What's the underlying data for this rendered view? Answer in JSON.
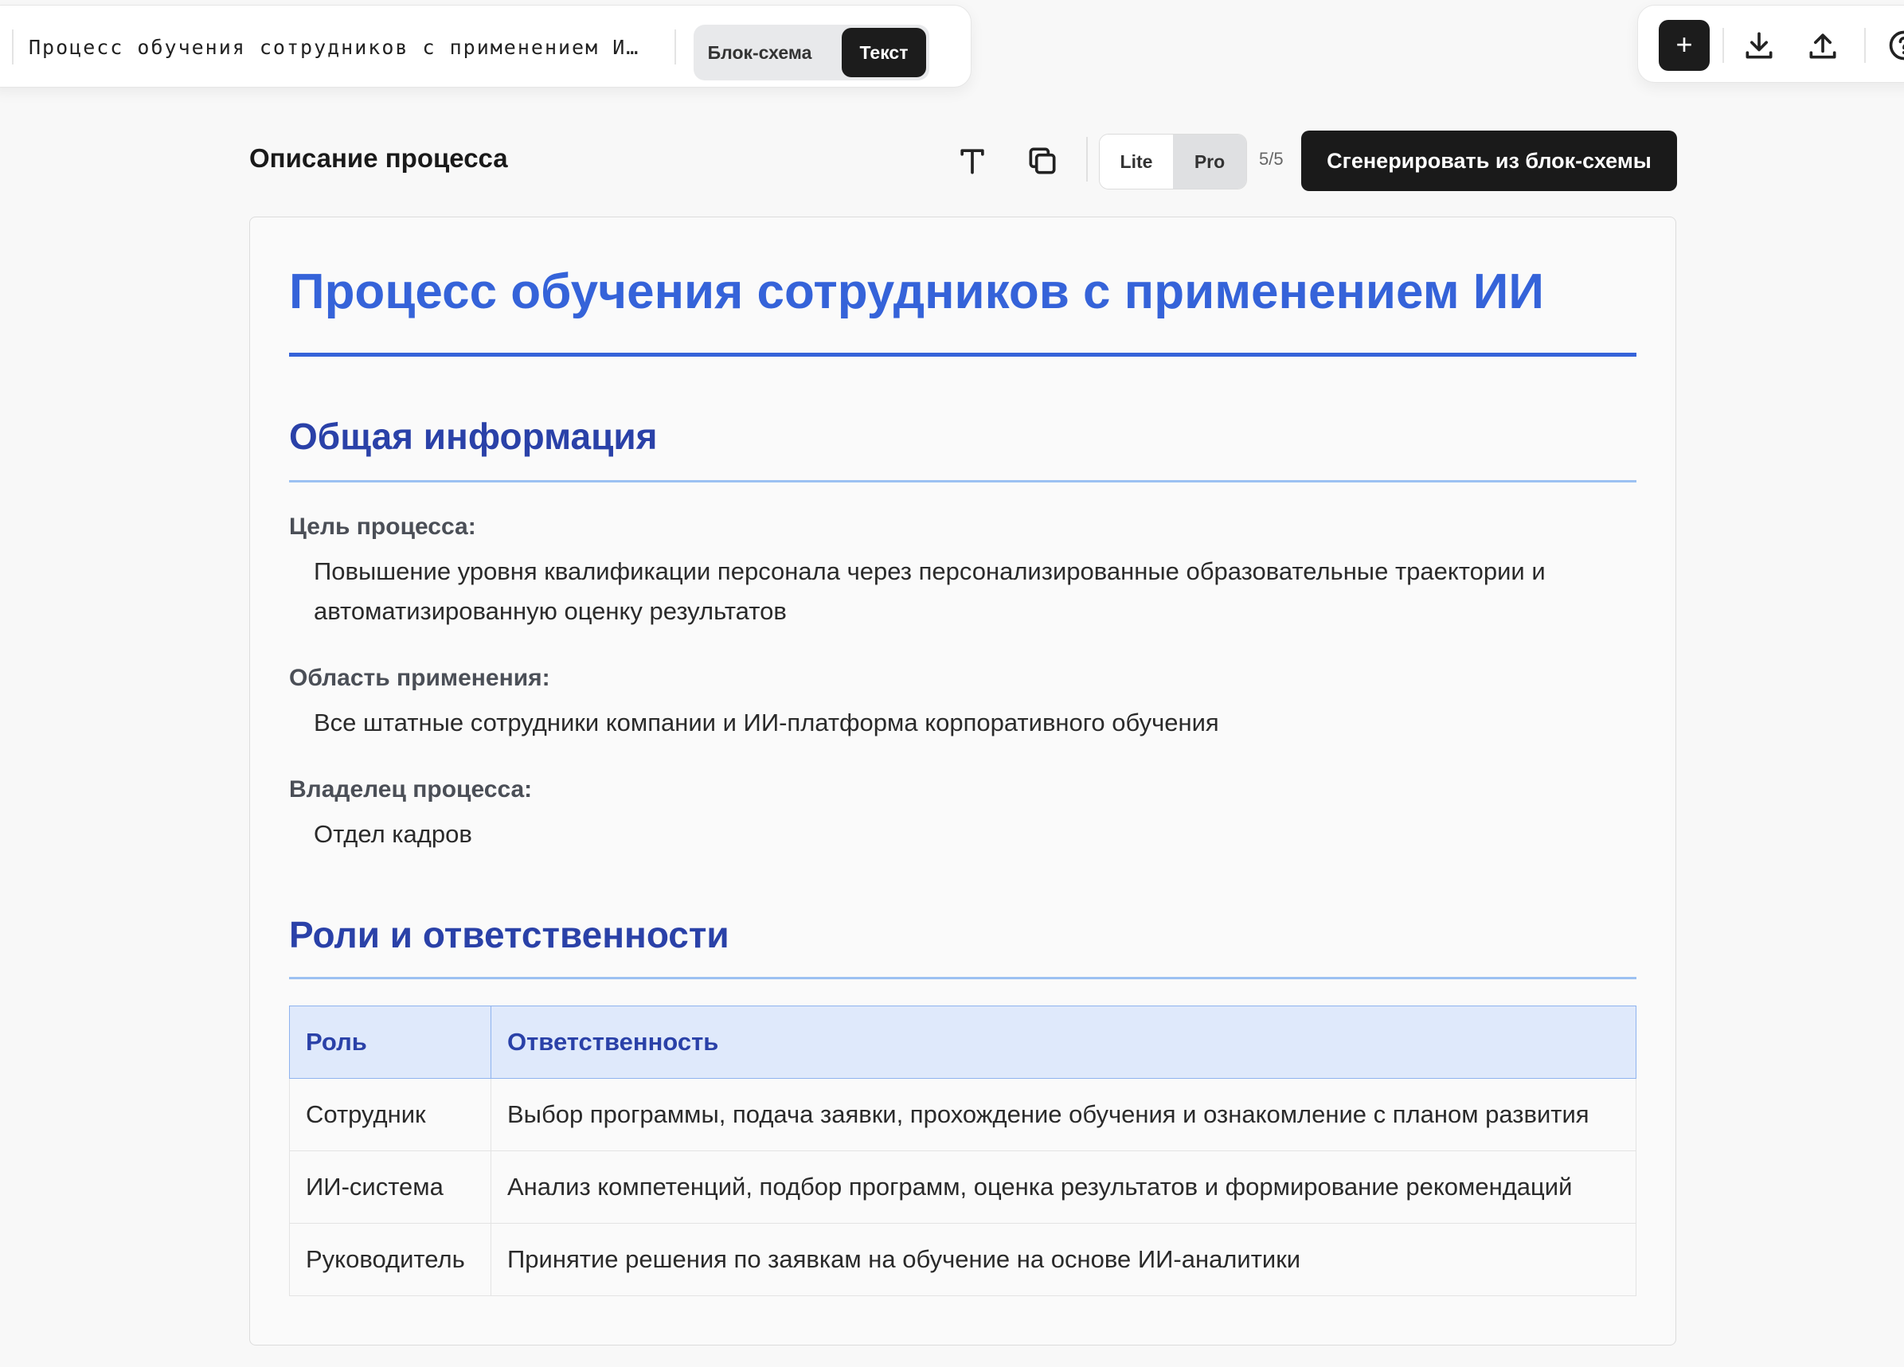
{
  "toolbar": {
    "doc_title": "Процесс обучения сотрудников с применением И…",
    "view_modes": {
      "flowchart": "Блок-схема",
      "text": "Текст"
    },
    "add_label": "+"
  },
  "header": {
    "title": "Описание процесса",
    "modes": {
      "lite": "Lite",
      "pro": "Pro"
    },
    "counter": "5/5",
    "generate_label": "Сгенерировать из блок-схемы"
  },
  "document": {
    "title": "Процесс обучения сотрудников с применением ИИ",
    "general": {
      "heading": "Общая информация",
      "goal_label": "Цель процесса:",
      "goal_value": "Повышение уровня квалификации персонала через персонализированные образовательные траектории и автоматизированную оценку результатов",
      "scope_label": "Область применения:",
      "scope_value": "Все штатные сотрудники компании и ИИ-платформа корпоративного обучения",
      "owner_label": "Владелец процесса:",
      "owner_value": "Отдел кадров"
    },
    "roles": {
      "heading": "Роли и ответственности",
      "columns": [
        "Роль",
        "Ответственность"
      ],
      "rows": [
        {
          "role": "Сотрудник",
          "resp": "Выбор программы, подача заявки, прохождение обучения и ознакомление с планом развития"
        },
        {
          "role": "ИИ-система",
          "resp": "Анализ компетенций, подбор программ, оценка результатов и формирование рекомендаций"
        },
        {
          "role": "Руководитель",
          "resp": "Принятие решения по заявкам на обучение на основе ИИ-аналитики"
        }
      ]
    }
  },
  "colors": {
    "accent": "#3563d9",
    "heading": "#2a41a8",
    "rule_light": "#9cc1f2",
    "button_dark": "#1a1a1a"
  },
  "icons": [
    "plus-icon",
    "download-icon",
    "upload-icon",
    "help-icon",
    "text-format-icon",
    "copy-icon"
  ]
}
